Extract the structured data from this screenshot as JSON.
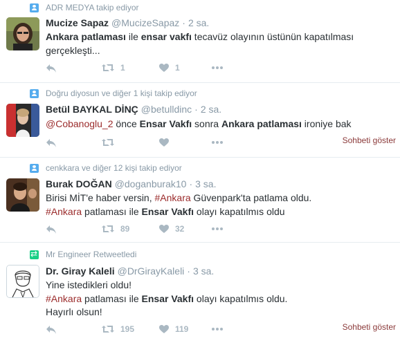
{
  "tweets": [
    {
      "context": "ADR MEDYA takip ediyor",
      "context_type": "follow",
      "name": "Mucize Sapaz",
      "handle": "@MucizeSapaz",
      "time": "2 sa.",
      "text_parts": [
        {
          "t": "Ankara patlaması",
          "s": "b"
        },
        {
          "t": " ile ",
          "s": ""
        },
        {
          "t": "ensar vakfı",
          "s": "b"
        },
        {
          "t": " tecavüz olayının üstünün kapatılması gerçekleşti...",
          "s": ""
        }
      ],
      "retweets": "1",
      "likes": "1",
      "show_conversation": ""
    },
    {
      "context": "Doğru diyosun ve diğer 1 kişi takip ediyor",
      "context_type": "follow",
      "name": "Betül BAYKAL DİNÇ",
      "handle": "@betulldinc",
      "time": "2 sa.",
      "text_parts": [
        {
          "t": "@Cobanoglu_2",
          "s": "link"
        },
        {
          "t": " önce ",
          "s": ""
        },
        {
          "t": "Ensar Vakfı",
          "s": "b"
        },
        {
          "t": " sonra ",
          "s": ""
        },
        {
          "t": "Ankara patlaması",
          "s": "b"
        },
        {
          "t": " ironiye bak",
          "s": ""
        }
      ],
      "retweets": "",
      "likes": "",
      "show_conversation": "Sohbeti göster"
    },
    {
      "context": "cenkkara ve diğer 12 kişi takip ediyor",
      "context_type": "follow",
      "name": "Burak DOĞAN",
      "handle": "@doganburak10",
      "time": "3 sa.",
      "text_parts": [
        {
          "t": "Birisi MİT'e haber versin, ",
          "s": ""
        },
        {
          "t": "#Ankara",
          "s": "link"
        },
        {
          "t": " Güvenpark'ta patlama oldu.",
          "s": ""
        },
        {
          "t": "\n",
          "s": "br"
        },
        {
          "t": "#Ankara",
          "s": "link"
        },
        {
          "t": " patlaması ile ",
          "s": ""
        },
        {
          "t": "Ensar Vakfı",
          "s": "b"
        },
        {
          "t": " olayı kapatılmıs oldu",
          "s": ""
        }
      ],
      "retweets": "89",
      "likes": "32",
      "show_conversation": ""
    },
    {
      "context": "Mr Engineer Retweetledi",
      "context_type": "retweet",
      "name": "Dr. Giray Kaleli",
      "handle": "@DrGirayKaleli",
      "time": "3 sa.",
      "text_parts": [
        {
          "t": "Yine istedikleri oldu!",
          "s": ""
        },
        {
          "t": "\n",
          "s": "br"
        },
        {
          "t": "#Ankara",
          "s": "link"
        },
        {
          "t": " patlaması ile ",
          "s": ""
        },
        {
          "t": "Ensar Vakfı",
          "s": "b"
        },
        {
          "t": " olayı kapatılmıs oldu.",
          "s": ""
        },
        {
          "t": "\n",
          "s": "br"
        },
        {
          "t": "Hayırlı olsun!",
          "s": ""
        }
      ],
      "retweets": "195",
      "likes": "119",
      "show_conversation": "Sohbeti göster"
    }
  ]
}
